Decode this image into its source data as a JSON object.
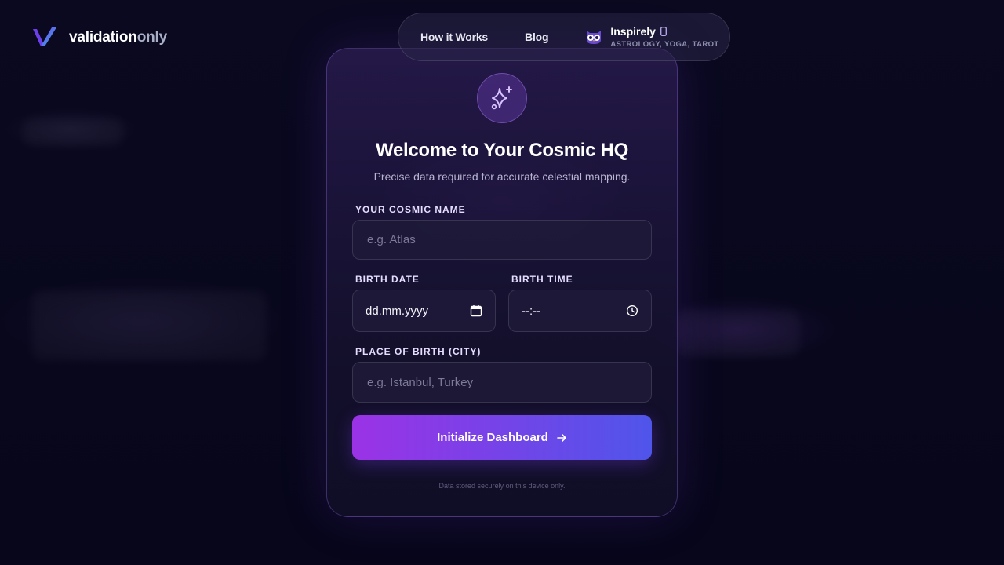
{
  "logo": {
    "text_a": "validation",
    "text_b": "only"
  },
  "nav": {
    "items": [
      {
        "label": "How it Works"
      },
      {
        "label": "Blog"
      }
    ],
    "brand": {
      "name": "Inspirely",
      "tagline": "ASTROLOGY, YOGA, TAROT"
    }
  },
  "card": {
    "title": "Welcome to Your Cosmic HQ",
    "subtitle": "Precise data required for accurate celestial mapping.",
    "name_label": "YOUR COSMIC NAME",
    "name_placeholder": "e.g. Atlas",
    "date_label": "BIRTH DATE",
    "date_value": "dd.mm.yyyy",
    "time_label": "BIRTH TIME",
    "time_value": "--:--",
    "place_label": "PLACE OF BIRTH (CITY)",
    "place_placeholder": "e.g. Istanbul, Turkey",
    "submit_label": "Initialize Dashboard",
    "footer_note": "Data stored securely on this device only."
  },
  "colors": {
    "accent_start": "#9b32e6",
    "accent_end": "#4f55ea",
    "background": "#07061a"
  },
  "icons": [
    "logo-v-icon",
    "owl-icon",
    "phone-icon",
    "sparkle-icon",
    "calendar-icon",
    "clock-icon",
    "arrow-right-icon"
  ]
}
